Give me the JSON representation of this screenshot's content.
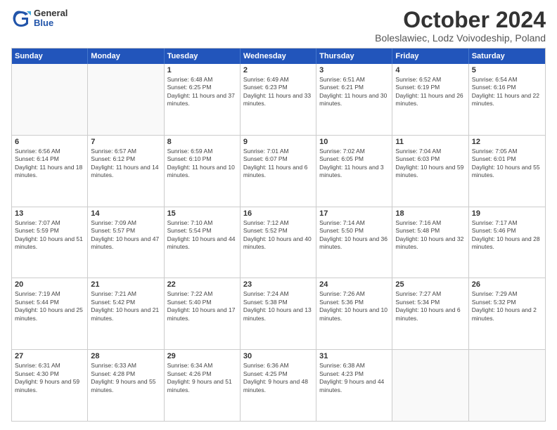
{
  "logo": {
    "general": "General",
    "blue": "Blue"
  },
  "title": "October 2024",
  "location": "Boleslawiec, Lodz Voivodeship, Poland",
  "days_of_week": [
    "Sunday",
    "Monday",
    "Tuesday",
    "Wednesday",
    "Thursday",
    "Friday",
    "Saturday"
  ],
  "weeks": [
    [
      {
        "day": "",
        "info": ""
      },
      {
        "day": "",
        "info": ""
      },
      {
        "day": "1",
        "info": "Sunrise: 6:48 AM\nSunset: 6:25 PM\nDaylight: 11 hours and 37 minutes."
      },
      {
        "day": "2",
        "info": "Sunrise: 6:49 AM\nSunset: 6:23 PM\nDaylight: 11 hours and 33 minutes."
      },
      {
        "day": "3",
        "info": "Sunrise: 6:51 AM\nSunset: 6:21 PM\nDaylight: 11 hours and 30 minutes."
      },
      {
        "day": "4",
        "info": "Sunrise: 6:52 AM\nSunset: 6:19 PM\nDaylight: 11 hours and 26 minutes."
      },
      {
        "day": "5",
        "info": "Sunrise: 6:54 AM\nSunset: 6:16 PM\nDaylight: 11 hours and 22 minutes."
      }
    ],
    [
      {
        "day": "6",
        "info": "Sunrise: 6:56 AM\nSunset: 6:14 PM\nDaylight: 11 hours and 18 minutes."
      },
      {
        "day": "7",
        "info": "Sunrise: 6:57 AM\nSunset: 6:12 PM\nDaylight: 11 hours and 14 minutes."
      },
      {
        "day": "8",
        "info": "Sunrise: 6:59 AM\nSunset: 6:10 PM\nDaylight: 11 hours and 10 minutes."
      },
      {
        "day": "9",
        "info": "Sunrise: 7:01 AM\nSunset: 6:07 PM\nDaylight: 11 hours and 6 minutes."
      },
      {
        "day": "10",
        "info": "Sunrise: 7:02 AM\nSunset: 6:05 PM\nDaylight: 11 hours and 3 minutes."
      },
      {
        "day": "11",
        "info": "Sunrise: 7:04 AM\nSunset: 6:03 PM\nDaylight: 10 hours and 59 minutes."
      },
      {
        "day": "12",
        "info": "Sunrise: 7:05 AM\nSunset: 6:01 PM\nDaylight: 10 hours and 55 minutes."
      }
    ],
    [
      {
        "day": "13",
        "info": "Sunrise: 7:07 AM\nSunset: 5:59 PM\nDaylight: 10 hours and 51 minutes."
      },
      {
        "day": "14",
        "info": "Sunrise: 7:09 AM\nSunset: 5:57 PM\nDaylight: 10 hours and 47 minutes."
      },
      {
        "day": "15",
        "info": "Sunrise: 7:10 AM\nSunset: 5:54 PM\nDaylight: 10 hours and 44 minutes."
      },
      {
        "day": "16",
        "info": "Sunrise: 7:12 AM\nSunset: 5:52 PM\nDaylight: 10 hours and 40 minutes."
      },
      {
        "day": "17",
        "info": "Sunrise: 7:14 AM\nSunset: 5:50 PM\nDaylight: 10 hours and 36 minutes."
      },
      {
        "day": "18",
        "info": "Sunrise: 7:16 AM\nSunset: 5:48 PM\nDaylight: 10 hours and 32 minutes."
      },
      {
        "day": "19",
        "info": "Sunrise: 7:17 AM\nSunset: 5:46 PM\nDaylight: 10 hours and 28 minutes."
      }
    ],
    [
      {
        "day": "20",
        "info": "Sunrise: 7:19 AM\nSunset: 5:44 PM\nDaylight: 10 hours and 25 minutes."
      },
      {
        "day": "21",
        "info": "Sunrise: 7:21 AM\nSunset: 5:42 PM\nDaylight: 10 hours and 21 minutes."
      },
      {
        "day": "22",
        "info": "Sunrise: 7:22 AM\nSunset: 5:40 PM\nDaylight: 10 hours and 17 minutes."
      },
      {
        "day": "23",
        "info": "Sunrise: 7:24 AM\nSunset: 5:38 PM\nDaylight: 10 hours and 13 minutes."
      },
      {
        "day": "24",
        "info": "Sunrise: 7:26 AM\nSunset: 5:36 PM\nDaylight: 10 hours and 10 minutes."
      },
      {
        "day": "25",
        "info": "Sunrise: 7:27 AM\nSunset: 5:34 PM\nDaylight: 10 hours and 6 minutes."
      },
      {
        "day": "26",
        "info": "Sunrise: 7:29 AM\nSunset: 5:32 PM\nDaylight: 10 hours and 2 minutes."
      }
    ],
    [
      {
        "day": "27",
        "info": "Sunrise: 6:31 AM\nSunset: 4:30 PM\nDaylight: 9 hours and 59 minutes."
      },
      {
        "day": "28",
        "info": "Sunrise: 6:33 AM\nSunset: 4:28 PM\nDaylight: 9 hours and 55 minutes."
      },
      {
        "day": "29",
        "info": "Sunrise: 6:34 AM\nSunset: 4:26 PM\nDaylight: 9 hours and 51 minutes."
      },
      {
        "day": "30",
        "info": "Sunrise: 6:36 AM\nSunset: 4:25 PM\nDaylight: 9 hours and 48 minutes."
      },
      {
        "day": "31",
        "info": "Sunrise: 6:38 AM\nSunset: 4:23 PM\nDaylight: 9 hours and 44 minutes."
      },
      {
        "day": "",
        "info": ""
      },
      {
        "day": "",
        "info": ""
      }
    ]
  ]
}
